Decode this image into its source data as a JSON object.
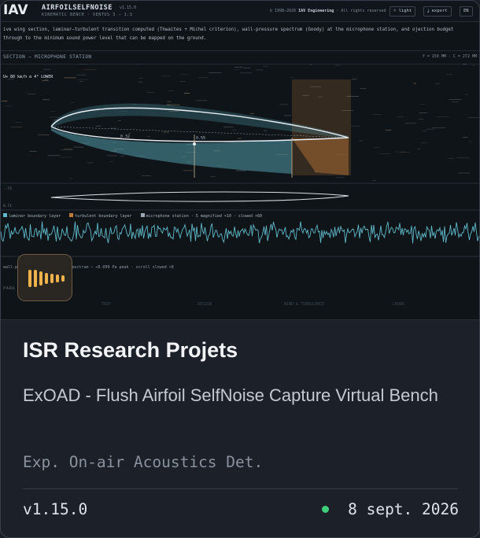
{
  "colors": {
    "accent_teal": "#5fb8c8",
    "turbulent_orange": "#c07a3a",
    "status_green": "#3ecf7a",
    "icon_amber": "#f0b24a"
  },
  "screenshot": {
    "logo": "IAV",
    "app_name": "AIRFOILSELFNOISE",
    "version_tag": "v1.15.0",
    "sub_name": "KINEMATIC BENCH · VENTUS 3 — 1:3",
    "copyright_prefix": "© 1998–2026",
    "copyright_org": "IAV Engineering",
    "copyright_suffix": "· All rights reserved",
    "btn_light": "☼ light",
    "btn_export": "⤓ export",
    "btn_lang": "EN",
    "description": "ive wing section, laminar–turbulent transition computed (Thwaites + Michel criterion), wall-pressure spectrum (Goody) at the microphone station, and ojection budget through to the minimum sound power level that can be mapped on the ground.",
    "section_title": "SECTION — MICROPHONE STATION",
    "section_meta": "Y = 150 MM · C = 272 MM",
    "flow_label": "U∞ 80 km/h  α 4° LOWER",
    "label_a": "0.32",
    "label_b": "0.55",
    "side_top": "-.73",
    "side_bottom": "0.71",
    "legend": [
      {
        "label": "laminar boundary layer",
        "color": "#5fb8c8"
      },
      {
        "label": "turbulent boundary layer",
        "color": "#c07a3a"
      },
      {
        "label": "microphone station · 5 magnified ×10 · slowed ×60",
        "color": "#9aa8b4"
      }
    ],
    "caption": "wall-p                d from the estimated spectrum — ≈0.009 Pa peak · scroll slowed ×8",
    "para_label": "PARA",
    "faint_cols": [
      "TRIP",
      "DESIGN",
      "WIND & TURBULENCE",
      "CHORD"
    ]
  },
  "card": {
    "title": "ISR Research Projets",
    "subtitle": "ExOAD - Flush Airfoil SelfNoise Capture Virtual Bench",
    "category": "Exp. On-air Acoustics Det.",
    "version": "v1.15.0",
    "date": "8 sept. 2026"
  }
}
